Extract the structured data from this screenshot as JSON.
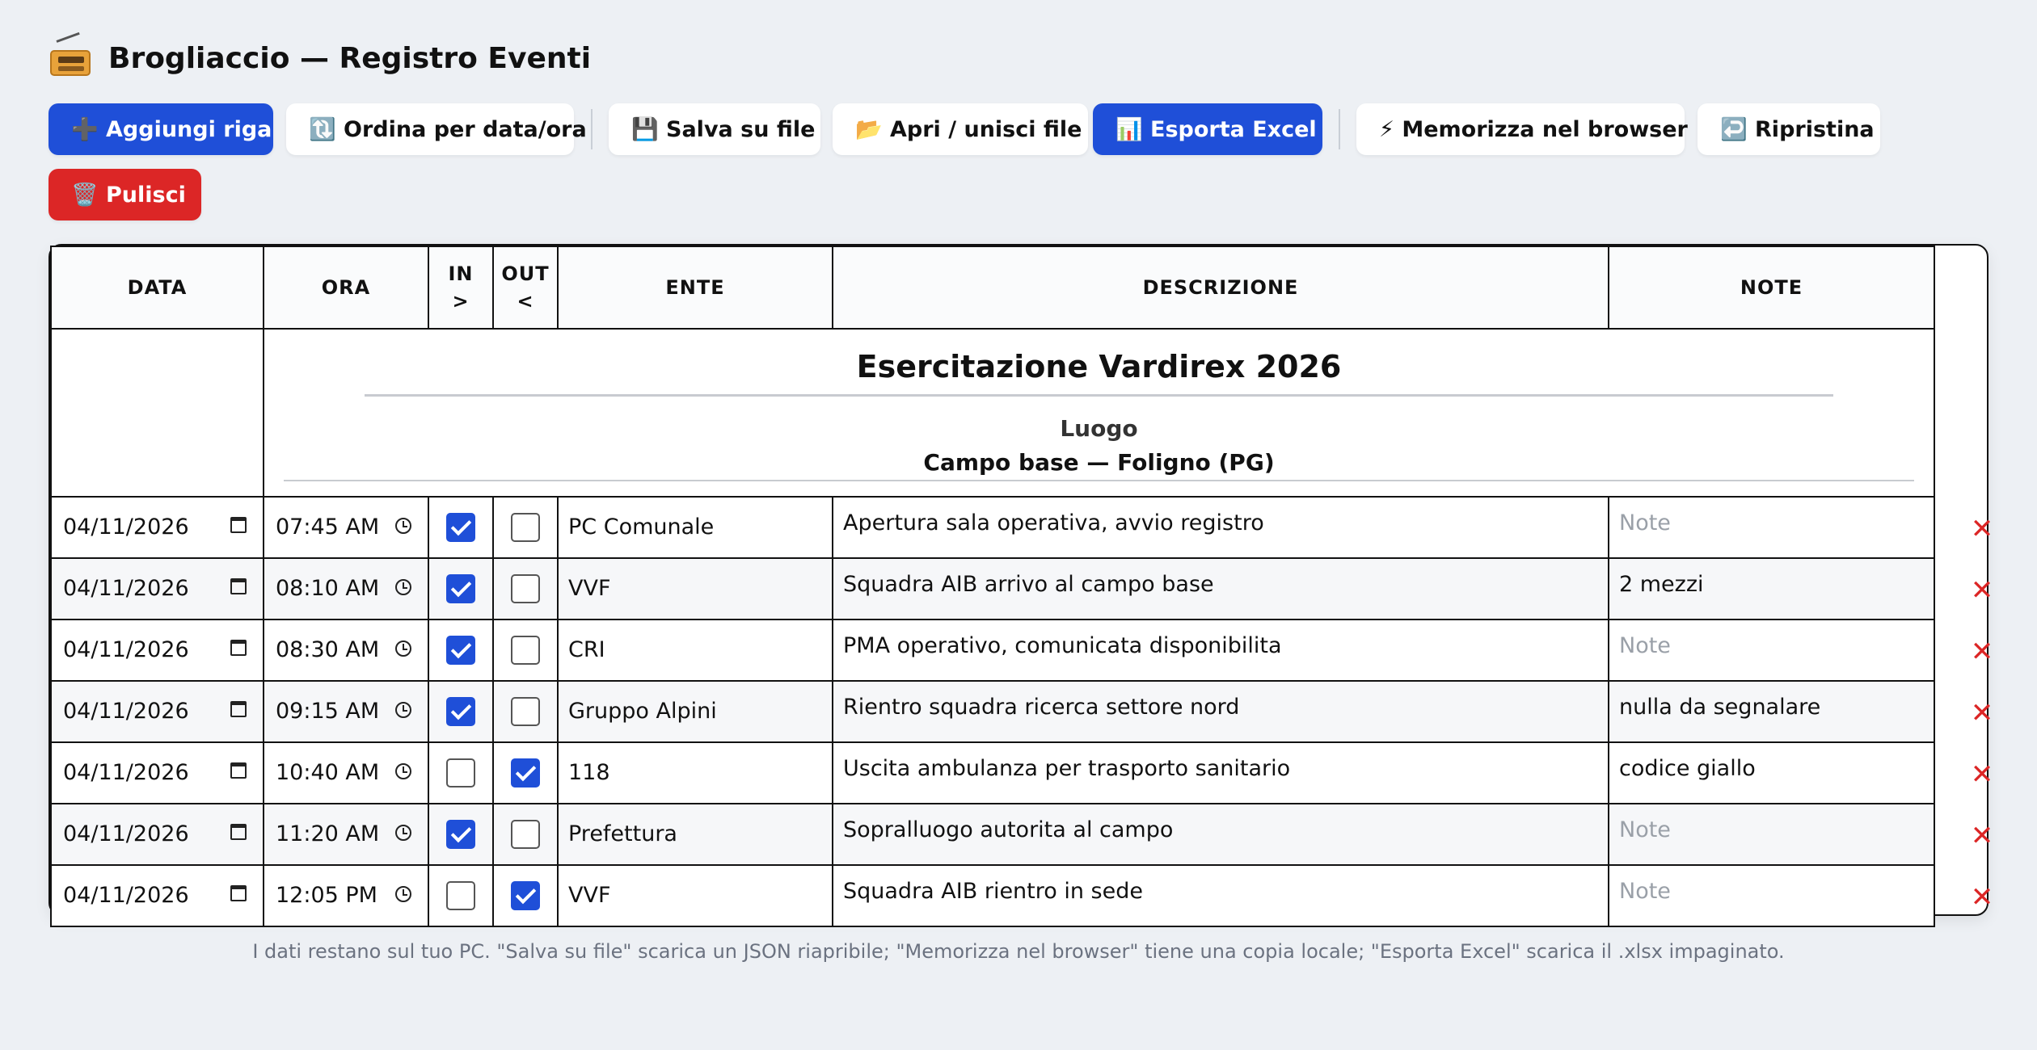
{
  "app": {
    "title": "Brogliaccio — Registro Eventi",
    "icon": "radio-icon"
  },
  "toolbar": {
    "add_row": "➕ Aggiungi riga",
    "sort": "🔃 Ordina per data/ora",
    "save_file": "💾 Salva su file",
    "open_merge": "📂 Apri / unisci file",
    "export_excel": "📊 Esporta Excel",
    "store_browser": "⚡ Memorizza nel browser",
    "restore": "↩️ Ripristina",
    "clear": "🗑️ Pulisci"
  },
  "colors": {
    "primary": "#1f4fd8",
    "danger": "#dc2626",
    "background": "#edf0f4",
    "placeholder": "#9aa0a8"
  },
  "table": {
    "headers": {
      "data": "DATA",
      "ora": "ORA",
      "in": "IN",
      "in_arrow": ">",
      "out": "OUT",
      "out_arrow": "<",
      "ente": "ENTE",
      "descrizione": "DESCRIZIONE",
      "note": "NOTE"
    },
    "event_title": "Esercitazione Vardirex 2026",
    "luogo_label": "Luogo",
    "luogo_value": "Campo base — Foligno (PG)",
    "note_placeholder": "Note",
    "delete_glyph": "✕",
    "rows": [
      {
        "date": "04/11/2026",
        "time": "07:45 AM",
        "in": true,
        "out": false,
        "ente": "PC Comunale",
        "descrizione": "Apertura sala operativa, avvio registro",
        "note": ""
      },
      {
        "date": "04/11/2026",
        "time": "08:10 AM",
        "in": true,
        "out": false,
        "ente": "VVF",
        "descrizione": "Squadra AIB arrivo al campo base",
        "note": "2 mezzi"
      },
      {
        "date": "04/11/2026",
        "time": "08:30 AM",
        "in": true,
        "out": false,
        "ente": "CRI",
        "descrizione": "PMA operativo, comunicata disponibilita",
        "note": ""
      },
      {
        "date": "04/11/2026",
        "time": "09:15 AM",
        "in": true,
        "out": false,
        "ente": "Gruppo Alpini",
        "descrizione": "Rientro squadra ricerca settore nord",
        "note": "nulla da segnalare"
      },
      {
        "date": "04/11/2026",
        "time": "10:40 AM",
        "in": false,
        "out": true,
        "ente": "118",
        "descrizione": "Uscita ambulanza per trasporto sanitario",
        "note": "codice giallo"
      },
      {
        "date": "04/11/2026",
        "time": "11:20 AM",
        "in": true,
        "out": false,
        "ente": "Prefettura",
        "descrizione": "Sopralluogo autorita al campo",
        "note": ""
      },
      {
        "date": "04/11/2026",
        "time": "12:05 PM",
        "in": false,
        "out": true,
        "ente": "VVF",
        "descrizione": "Squadra AIB rientro in sede",
        "note": ""
      }
    ]
  },
  "footer": {
    "note": "I dati restano sul tuo PC. \"Salva su file\" scarica un JSON riapribile; \"Memorizza nel browser\" tiene una copia locale; \"Esporta Excel\" scarica il .xlsx impaginato."
  }
}
